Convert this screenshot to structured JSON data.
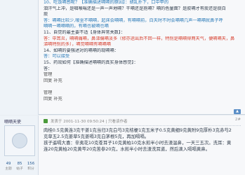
{
  "post1": {
    "lines": [
      {
        "text": "10、吃饭嗝感呢？【准确描述嗝嗝的原因】：胡乱扑下，口中甲的",
        "cls": "hl"
      },
      {
        "text": "泪汗气上冲，是咽喉喘还是一声一声地嗝？干嗝还是抱嗝？嗝的色量面？是胶嗝才有痰还是痰白",
        "cls": ""
      },
      {
        "text": "痰",
        "cls": ""
      },
      {
        "text": "答：嗝嗝比较少,嗳坐不嗝嗝，起床会嗝嗝，有嗝嗝前，白天时不时会嗝嗝几声一嗝嗝就鼻子呼",
        "cls": "hl"
      },
      {
        "text": "嗝嗝一嗝嗝嗝的，有嗝也被嗝也嗝",
        "cls": "hl"
      },
      {
        "text": "11、自觉的最主要不适【身体异常关数】：",
        "cls": ""
      },
      {
        "text": "答：中耳炎，嗝嗝痛嗝，鼻涕偏嗝淡多（修亦运出后不回一样，特别是嗝嗝得两天气，便嗝嗝天，鼻",
        "cls": "red"
      },
      {
        "text": "涕嗝特别的多），嗝觉嗝嗝有嗝嗝嗝",
        "cls": "red"
      },
      {
        "text": "14、如嗝的要强述对的嗝嗝的现嗝嗝：",
        "cls": ""
      },
      {
        "text": "答：可以接受",
        "cls": "hl"
      },
      {
        "text": "15、药效如何【准确描述嗝嗝的真实身体感觉】：",
        "cls": ""
      },
      {
        "text": "答：",
        "cls": ""
      },
      {
        "text": "管理",
        "cls": "muted"
      },
      {
        "text": "回复 补充",
        "cls": "muted"
      },
      {
        "text": "",
        "cls": ""
      },
      {
        "text": "管理",
        "cls": "muted"
      },
      {
        "text": "回复 补充",
        "cls": "muted"
      }
    ],
    "scroll_label": "▲"
  },
  "post2": {
    "username": "嗝嗝天使",
    "stats": [
      {
        "value": "49",
        "label": "主题"
      },
      {
        "value": "85",
        "label": "帖子"
      },
      {
        "value": "156",
        "label": "积分"
      }
    ],
    "header_text": "发表于 2001-11-30 09:50:24  | 只看该作者",
    "floor": "2#",
    "body_lines": [
      "肉桂0.5克黄连3克干姜1克当归3克白芍3克桔梗1克玉米子0.5克黄细9克黄附9克厚朴3克赤芍2",
      "克草五2.5克姜草5克姜嗝3克白茅根5克，再加嗝嗝。",
      "孩子遥嗝大喜：辛夷花10克苍耳子10克黄柏10克水煎半小时去渣温鼻，一天三五次。洗耳：黄",
      "连20克黄柏20克黄芩20克苦参20克，水煎半小时去渣洗耳道，然后滴入嗝嗝黄鼻。"
    ]
  }
}
